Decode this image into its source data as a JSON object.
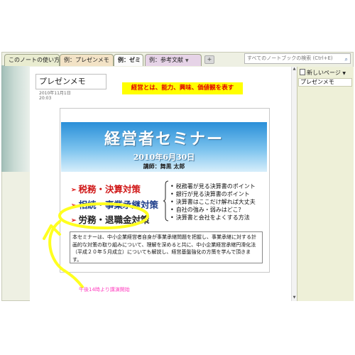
{
  "tabs": [
    {
      "label": "このノートの使い方"
    },
    {
      "label": "例：プレゼンメモ"
    },
    {
      "label": "例：ゼミ"
    },
    {
      "label": "例：参考文献"
    }
  ],
  "tab_add_label": "+",
  "search": {
    "placeholder": "すべてのノートブックの検索 (Ctrl+E)"
  },
  "sidebar": {
    "new_page_label": "新しいページ",
    "pages": [
      {
        "label": "プレゼンメモ"
      }
    ]
  },
  "page": {
    "title": "プレゼンメモ",
    "date": "2010年11月1日",
    "time": "20:03",
    "highlight_note": "経営とは、能力、興味、価値観を表す"
  },
  "slide": {
    "title": "経営者セミナー",
    "date": "2010年6月30日",
    "lecturer": "講師：舞黒 太郎",
    "topics": [
      {
        "label": "税務・決算対策"
      },
      {
        "label": "相続・事業承継対策"
      },
      {
        "label": "労務・退職金対策"
      }
    ],
    "topic_bullet": "➢",
    "points": [
      {
        "label": "税務署が見る決算書のポイント"
      },
      {
        "label": "銀行が見る決算書のポイント"
      },
      {
        "label": "決算書はここだけ解れば大丈夫"
      },
      {
        "label": "自社の強み・弱みはどこ？"
      },
      {
        "label": "決算書と会社をよくする方法"
      }
    ],
    "point_bullet": "•",
    "description": "本セミナーは、中小企業経営者自身が事業承継問題を把握し、事業承継に対する計画的な対策の取り組みについて、理解を深めると共に、中小企業経営承継円滑化法（平成２０年５月成立）についても解説し、経営基盤強化の方策を学んで頂きます。"
  },
  "handwritten_note": "午後14時より講演開始",
  "colors": {
    "highlight_bg": "#ffff00",
    "highlight_text": "#e00000",
    "topic_red": "#d01818",
    "topic_blue": "#1d3d8a",
    "ink_yellow": "#ffff20",
    "ink_pink": "#ff40c0",
    "banner_blue": "#2a8fd8"
  },
  "icons": {
    "search": "magnifier-icon",
    "tab_dropdown": "chevron-down-icon",
    "new_page": "new-page-icon"
  }
}
